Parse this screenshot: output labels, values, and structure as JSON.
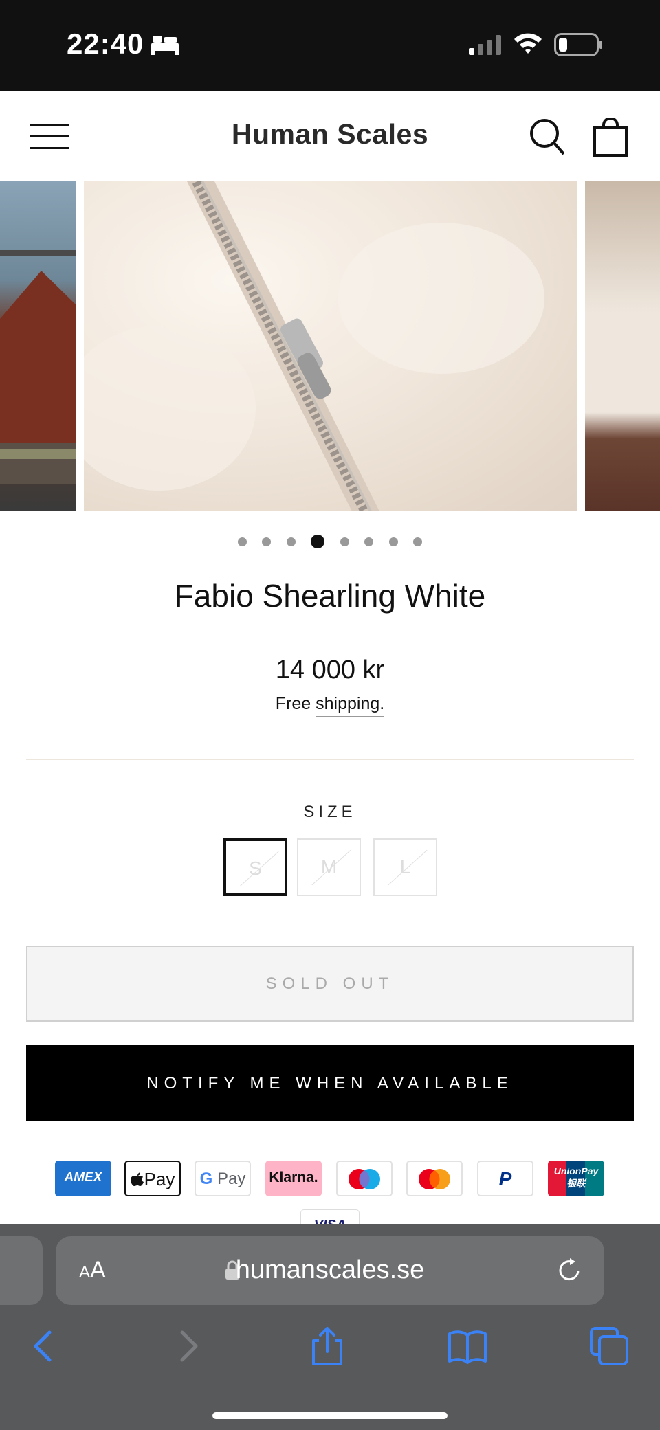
{
  "status_bar": {
    "time": "22:40",
    "icons": [
      "bed-icon",
      "signal-icon",
      "wifi-icon",
      "battery-icon"
    ]
  },
  "header": {
    "brand": "Human Scales",
    "icons": [
      "menu-icon",
      "search-icon",
      "cart-icon"
    ]
  },
  "gallery": {
    "slide_count": 8,
    "active_index": 3
  },
  "product": {
    "title": "Fabio Shearling White",
    "price": "14 000 kr",
    "shipping_prefix": "Free",
    "shipping_link": "shipping."
  },
  "size": {
    "label": "SIZE",
    "options": [
      "S",
      "M",
      "L"
    ],
    "selected": "S"
  },
  "buttons": {
    "sold_out": "SOLD OUT",
    "notify": "NOTIFY ME WHEN AVAILABLE"
  },
  "payment_methods": [
    {
      "name": "American Express",
      "label": "AMEX"
    },
    {
      "name": "Apple Pay",
      "label": "Pay"
    },
    {
      "name": "Google Pay",
      "label": "Pay"
    },
    {
      "name": "Klarna",
      "label": "Klarna."
    },
    {
      "name": "Maestro",
      "label": ""
    },
    {
      "name": "Mastercard",
      "label": ""
    },
    {
      "name": "PayPal",
      "label": "P"
    },
    {
      "name": "UnionPay",
      "label": "UnionPay",
      "sublabel": "银联"
    },
    {
      "name": "Visa",
      "label": "VISA"
    }
  ],
  "browser": {
    "text_size_label_small": "A",
    "text_size_label_large": "A",
    "url": "humanscales.se",
    "toolbar": [
      "back-icon",
      "forward-icon",
      "share-icon",
      "bookmarks-icon",
      "tabs-icon"
    ]
  },
  "colors": {
    "status_bar_bg": "#111111",
    "browser_chrome_bg": "#58595b",
    "accent_blue": "#3b82f6",
    "notify_button_bg": "#000000"
  }
}
